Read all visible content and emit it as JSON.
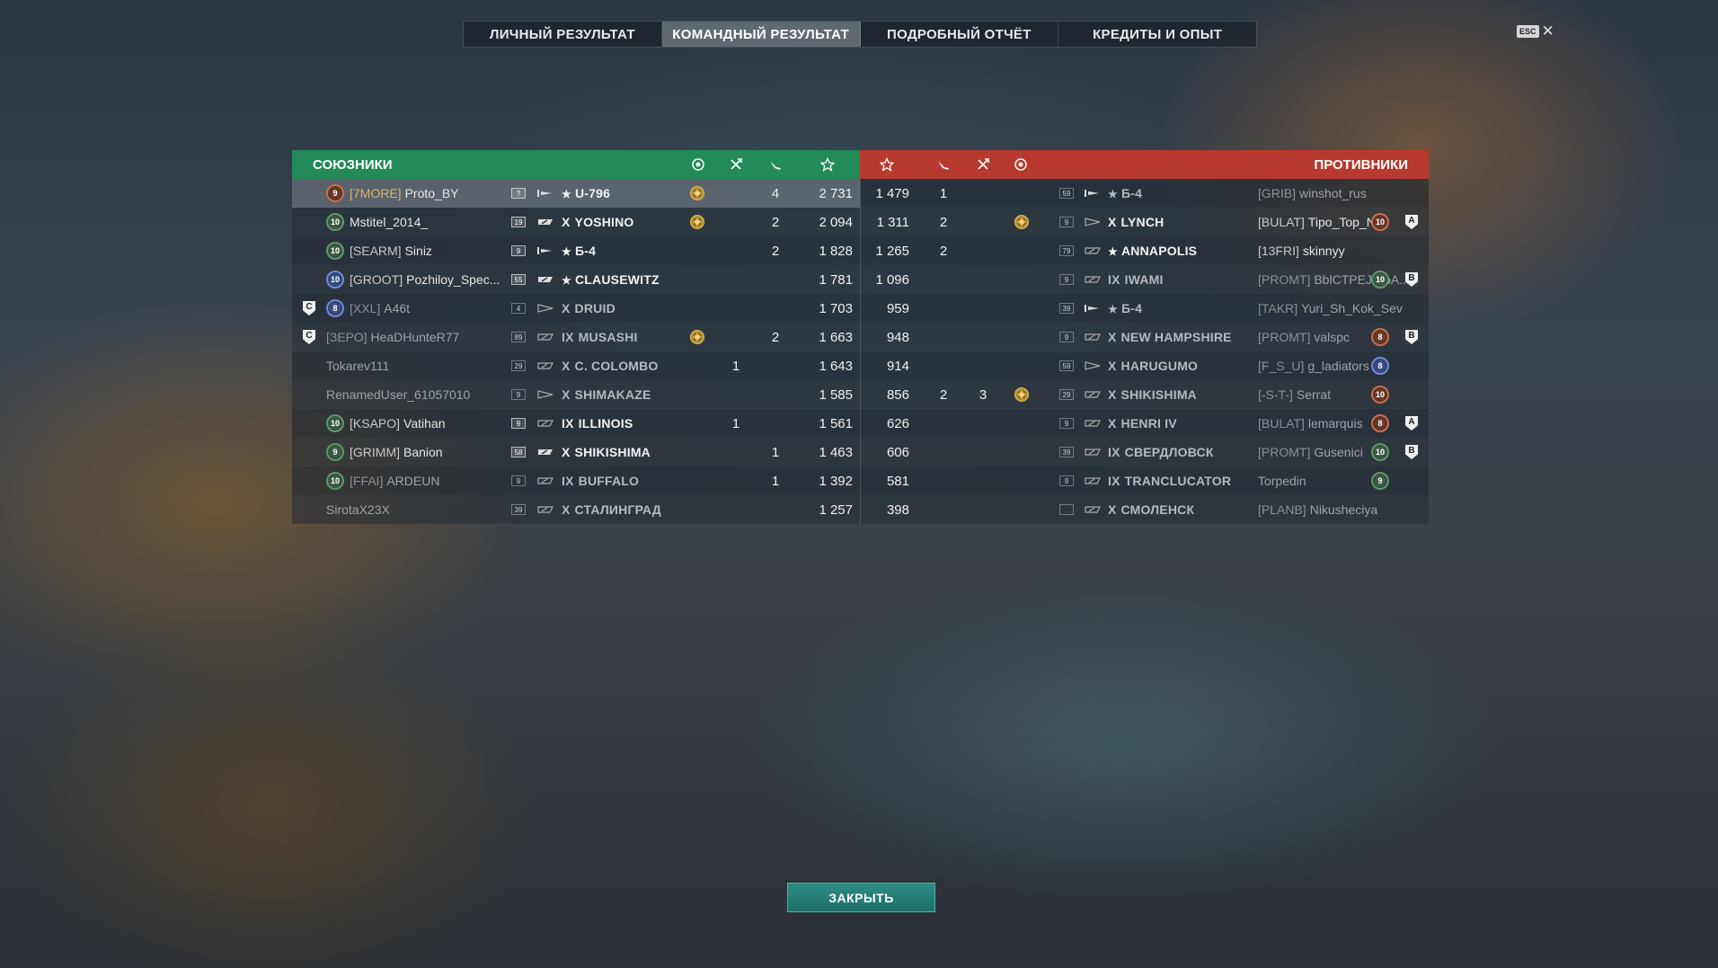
{
  "tabs": [
    {
      "label": "ЛИЧНЫЙ РЕЗУЛЬТАТ",
      "active": false
    },
    {
      "label": "КОМАНДНЫЙ РЕЗУЛЬТАТ",
      "active": true
    },
    {
      "label": "ПОДРОБНЫЙ ОТЧЁТ",
      "active": false
    },
    {
      "label": "КРЕДИТЫ И ОПЫТ",
      "active": false
    }
  ],
  "esc": {
    "badge": "ESC",
    "close": "✕"
  },
  "allies_title": "СОЮЗНИКИ",
  "enemies_title": "ПРОТИВНИКИ",
  "header_icons": {
    "allies": [
      "ribbon-medal-icon",
      "destroyed-planes-icon",
      "kills-icon",
      "experience-star-icon"
    ],
    "enemies": [
      "experience-star-icon",
      "kills-icon",
      "destroyed-planes-icon",
      "ribbon-medal-icon"
    ]
  },
  "colors": {
    "allies": "#238a5a",
    "enemies": "#b8392d",
    "accent_button": "#2e8c86"
  },
  "allies": [
    {
      "clan": "[7MORE]",
      "name": "Proto_BY",
      "rank": "9",
      "rank_color": "bronze",
      "level": "?",
      "ship_class": "submarine",
      "tier": "",
      "star": true,
      "ship": "U-796",
      "medal": true,
      "planes": "",
      "kills": "4",
      "xp": "2 731",
      "me": true,
      "dim": false,
      "division": ""
    },
    {
      "clan": "",
      "name": "Mstitel_2014_",
      "rank": "10",
      "rank_color": "green",
      "level": "19",
      "ship_class": "destroyer",
      "tier": "X",
      "star": false,
      "ship": "YOSHINO",
      "medal": true,
      "planes": "",
      "kills": "2",
      "xp": "2 094",
      "me": false,
      "dim": false,
      "division": ""
    },
    {
      "clan": "[SEARM]",
      "name": "Siniz",
      "rank": "10",
      "rank_color": "green",
      "level": "9",
      "ship_class": "submarine",
      "tier": "",
      "star": true,
      "ship": "Б-4",
      "medal": false,
      "planes": "",
      "kills": "2",
      "xp": "1 828",
      "me": false,
      "dim": false,
      "division": ""
    },
    {
      "clan": "[GROOT]",
      "name": "Pozhiloy_Spec...",
      "rank": "10",
      "rank_color": "blue",
      "level": "55",
      "ship_class": "destroyer",
      "tier": "",
      "star": true,
      "ship": "CLAUSEWITZ",
      "medal": false,
      "planes": "",
      "kills": "",
      "xp": "1 781",
      "me": false,
      "dim": false,
      "division": ""
    },
    {
      "clan": "[XXL]",
      "name": "A46t",
      "rank": "8",
      "rank_color": "blue",
      "level": "4",
      "ship_class": "cruiser",
      "tier": "X",
      "star": false,
      "ship": "DRUID",
      "medal": false,
      "planes": "",
      "kills": "",
      "xp": "1 703",
      "me": false,
      "dim": true,
      "division": "C"
    },
    {
      "clan": "[ЗЕРО]",
      "name": "HeaDHunteR77",
      "rank": "",
      "rank_color": "",
      "level": "89",
      "ship_class": "battleship",
      "tier": "IX",
      "star": false,
      "ship": "MUSASHI",
      "medal": true,
      "planes": "",
      "kills": "2",
      "xp": "1 663",
      "me": false,
      "dim": true,
      "division": "C"
    },
    {
      "clan": "",
      "name": "Tokarev111",
      "rank": "",
      "rank_color": "",
      "level": "29",
      "ship_class": "battleship",
      "tier": "X",
      "star": false,
      "ship": "C. COLOMBO",
      "medal": false,
      "planes": "1",
      "kills": "",
      "xp": "1 643",
      "me": false,
      "dim": true,
      "division": ""
    },
    {
      "clan": "",
      "name": "RenamedUser_61057010",
      "rank": "",
      "rank_color": "",
      "level": "9",
      "ship_class": "cruiser",
      "tier": "X",
      "star": false,
      "ship": "SHIMAKAZE",
      "medal": false,
      "planes": "",
      "kills": "",
      "xp": "1 585",
      "me": false,
      "dim": true,
      "division": ""
    },
    {
      "clan": "[KSAPO]",
      "name": "Vatihan",
      "rank": "10",
      "rank_color": "green",
      "level": "9",
      "ship_class": "battleship",
      "tier": "IX",
      "star": false,
      "ship": "ILLINOIS",
      "medal": false,
      "planes": "1",
      "kills": "",
      "xp": "1 561",
      "me": false,
      "dim": false,
      "division": ""
    },
    {
      "clan": "[GRIMM]",
      "name": "Banion",
      "rank": "9",
      "rank_color": "green",
      "level": "58",
      "ship_class": "destroyer",
      "tier": "X",
      "star": false,
      "ship": "SHIKISHIMA",
      "medal": false,
      "planes": "",
      "kills": "1",
      "xp": "1 463",
      "me": false,
      "dim": false,
      "division": ""
    },
    {
      "clan": "[FFAI]",
      "name": "ARDEUN",
      "rank": "10",
      "rank_color": "green",
      "level": "9",
      "ship_class": "battleship",
      "tier": "IX",
      "star": false,
      "ship": "BUFFALO",
      "medal": false,
      "planes": "",
      "kills": "1",
      "xp": "1 392",
      "me": false,
      "dim": true,
      "division": ""
    },
    {
      "clan": "",
      "name": "SirotaX23X",
      "rank": "",
      "rank_color": "",
      "level": "39",
      "ship_class": "battleship",
      "tier": "X",
      "star": false,
      "ship": "СТАЛИНГРАД",
      "medal": false,
      "planes": "",
      "kills": "",
      "xp": "1 257",
      "me": false,
      "dim": true,
      "division": ""
    }
  ],
  "enemies": [
    {
      "xp": "1 479",
      "kills": "1",
      "planes": "",
      "medal": false,
      "level": "59",
      "ship_class": "submarine",
      "tier": "",
      "star": true,
      "ship": "Б-4",
      "clan": "[GRIB]",
      "name": "winshot_rus",
      "rank": "",
      "rank_color": "",
      "division": "",
      "dim": true
    },
    {
      "xp": "1 311",
      "kills": "2",
      "planes": "",
      "medal": true,
      "level": "9",
      "ship_class": "cruiser",
      "tier": "X",
      "star": false,
      "ship": "LYNCH",
      "clan": "[BULAT]",
      "name": "Tipo_Top_Nik",
      "rank": "10",
      "rank_color": "bronze",
      "division": "A",
      "dim": false
    },
    {
      "xp": "1 265",
      "kills": "2",
      "planes": "",
      "medal": false,
      "level": "79",
      "ship_class": "battleship",
      "tier": "",
      "star": true,
      "ship": "ANNAPOLIS",
      "clan": "[13FRI]",
      "name": "skinnyy",
      "rank": "",
      "rank_color": "",
      "division": "",
      "dim": false
    },
    {
      "xp": "1 096",
      "kills": "",
      "planes": "",
      "medal": false,
      "level": "9",
      "ship_class": "battleship",
      "tier": "IX",
      "star": false,
      "ship": "IWAMI",
      "clan": "[PROMT]",
      "name": "BblCTPEJIBbA...",
      "rank": "10",
      "rank_color": "green",
      "division": "B",
      "dim": true
    },
    {
      "xp": "959",
      "kills": "",
      "planes": "",
      "medal": false,
      "level": "39",
      "ship_class": "submarine",
      "tier": "",
      "star": true,
      "ship": "Б-4",
      "clan": "[TAKR]",
      "name": "Yuri_Sh_Kok_Sev",
      "rank": "",
      "rank_color": "",
      "division": "",
      "dim": true
    },
    {
      "xp": "948",
      "kills": "",
      "planes": "",
      "medal": false,
      "level": "9",
      "ship_class": "battleship",
      "tier": "X",
      "star": false,
      "ship": "NEW HAMPSHIRE",
      "clan": "[PROMT]",
      "name": "valspc",
      "rank": "8",
      "rank_color": "bronze",
      "division": "B",
      "dim": true
    },
    {
      "xp": "914",
      "kills": "",
      "planes": "",
      "medal": false,
      "level": "59",
      "ship_class": "cruiser",
      "tier": "X",
      "star": false,
      "ship": "HARUGUMO",
      "clan": "[F_S_U]",
      "name": "g_ladiators",
      "rank": "8",
      "rank_color": "blue",
      "division": "",
      "dim": true
    },
    {
      "xp": "856",
      "kills": "2",
      "planes": "3",
      "medal": true,
      "level": "29",
      "ship_class": "battleship",
      "tier": "X",
      "star": false,
      "ship": "SHIKISHIMA",
      "clan": "[-S-T-]",
      "name": "Serrat",
      "rank": "10",
      "rank_color": "bronze",
      "division": "",
      "dim": true
    },
    {
      "xp": "626",
      "kills": "",
      "planes": "",
      "medal": false,
      "level": "9",
      "ship_class": "battleship",
      "tier": "X",
      "star": false,
      "ship": "HENRI IV",
      "clan": "[BULAT]",
      "name": "lemarquis",
      "rank": "8",
      "rank_color": "bronze",
      "division": "A",
      "dim": true
    },
    {
      "xp": "606",
      "kills": "",
      "planes": "",
      "medal": false,
      "level": "39",
      "ship_class": "battleship",
      "tier": "IX",
      "star": false,
      "ship": "СВЕРДЛОВСК",
      "clan": "[PROMT]",
      "name": "Gusenici",
      "rank": "10",
      "rank_color": "green",
      "division": "B",
      "dim": true
    },
    {
      "xp": "581",
      "kills": "",
      "planes": "",
      "medal": false,
      "level": "9",
      "ship_class": "battleship",
      "tier": "IX",
      "star": false,
      "ship": "TRANCLUCATOR",
      "clan": "",
      "name": "Torpedin",
      "rank": "9",
      "rank_color": "green",
      "division": "",
      "dim": true
    },
    {
      "xp": "398",
      "kills": "",
      "planes": "",
      "medal": false,
      "level": "",
      "ship_class": "battleship",
      "tier": "X",
      "star": false,
      "ship": "СМОЛЕНСК",
      "clan": "[PLANB]",
      "name": "Nikusheciya",
      "rank": "",
      "rank_color": "",
      "division": "",
      "dim": true
    }
  ],
  "close_button": "ЗАКРЫТЬ"
}
